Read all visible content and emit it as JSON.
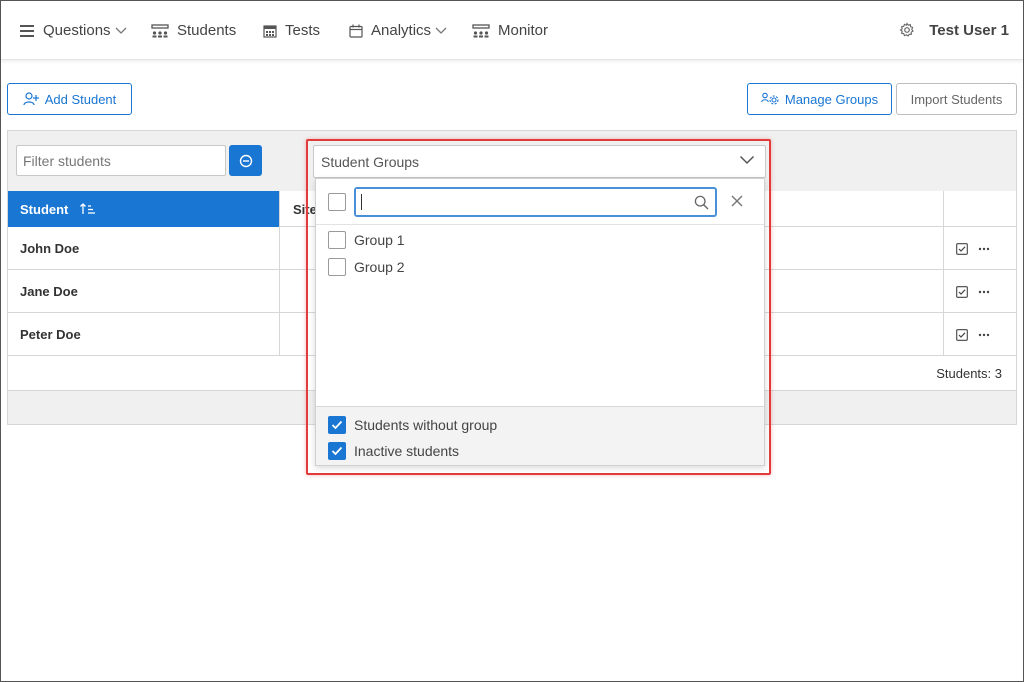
{
  "nav": {
    "items": [
      {
        "label": "Questions",
        "icon": "list-icon",
        "has_dropdown": true
      },
      {
        "label": "Students",
        "icon": "students-icon",
        "has_dropdown": false
      },
      {
        "label": "Tests",
        "icon": "calendar-grid-icon",
        "has_dropdown": false
      },
      {
        "label": "Analytics",
        "icon": "calendar-icon",
        "has_dropdown": true
      },
      {
        "label": "Monitor",
        "icon": "monitor-icon",
        "has_dropdown": false
      }
    ],
    "settings_icon": "gear-icon",
    "user": "Test User 1"
  },
  "actions": {
    "add_student": "Add Student",
    "manage_groups": "Manage Groups",
    "import_students": "Import Students"
  },
  "filter": {
    "placeholder": "Filter students"
  },
  "table": {
    "columns": {
      "student": "Student",
      "site": "Site"
    },
    "rows": [
      {
        "name": "John Doe"
      },
      {
        "name": "Jane Doe"
      },
      {
        "name": "Peter Doe"
      }
    ],
    "count": "Students: 3"
  },
  "groups_dropdown": {
    "title": "Student Groups",
    "search_value": "",
    "options": [
      {
        "label": "Group 1",
        "checked": false
      },
      {
        "label": "Group 2",
        "checked": false
      }
    ],
    "footer_options": [
      {
        "label": "Students without group",
        "checked": true
      },
      {
        "label": "Inactive students",
        "checked": true
      }
    ]
  },
  "colors": {
    "accent": "#1976d2",
    "highlight": "#e03c3c"
  }
}
